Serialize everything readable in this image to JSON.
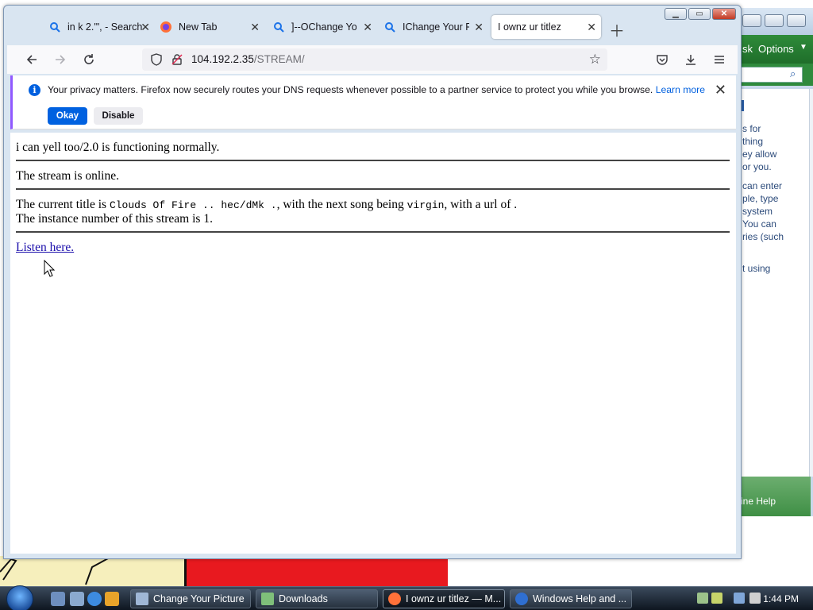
{
  "browser": {
    "tabs": [
      {
        "label": "in k 2.'\", - Search",
        "icon": "search-icon"
      },
      {
        "label": "New Tab",
        "icon": "firefox-icon"
      },
      {
        "label": "]--OChange Your Picture",
        "icon": "search-icon"
      },
      {
        "label": "IChange Your Picture",
        "icon": "search-icon"
      },
      {
        "label": "I ownz ur titlez",
        "icon": "none"
      }
    ],
    "url_host": "104.192.2.35",
    "url_path": "/STREAM/"
  },
  "notification": {
    "message": "Your privacy matters. Firefox now securely routes your DNS requests whenever possible to a partner service to protect you while you browse.",
    "learn_more": "Learn more",
    "okay_label": "Okay",
    "disable_label": "Disable"
  },
  "page": {
    "status_line": "i can yell too/2.0 is functioning normally.",
    "online_line": "The stream is online.",
    "title_prefix": "The current title is",
    "current_title": "Clouds Of Fire .. hec/dMk .",
    "next_prefix": ", with the next song being",
    "next_song": "virgin",
    "url_suffix": ", with a url of .",
    "instance_line": "The instance number of this stream is 1.",
    "listen_link": "Listen here."
  },
  "help_window": {
    "toolbar_left": "sk",
    "options_label": "Options",
    "lines": [
      "s for",
      "thing",
      "ey allow",
      "or you.",
      "can enter",
      "ple, type",
      "system",
      "You can",
      "ries (such",
      "t using"
    ],
    "footer": "ine Help"
  },
  "taskbar": {
    "buttons": [
      {
        "label": "Change Your Picture"
      },
      {
        "label": "Downloads"
      },
      {
        "label": "I ownz ur titlez — M..."
      },
      {
        "label": "Windows Help and ..."
      }
    ],
    "clock": "1:44 PM"
  },
  "colors": {
    "accent_blue": "#0061e0",
    "notification_stripe": "#9059ff",
    "help_green": "#2e8b3a"
  }
}
